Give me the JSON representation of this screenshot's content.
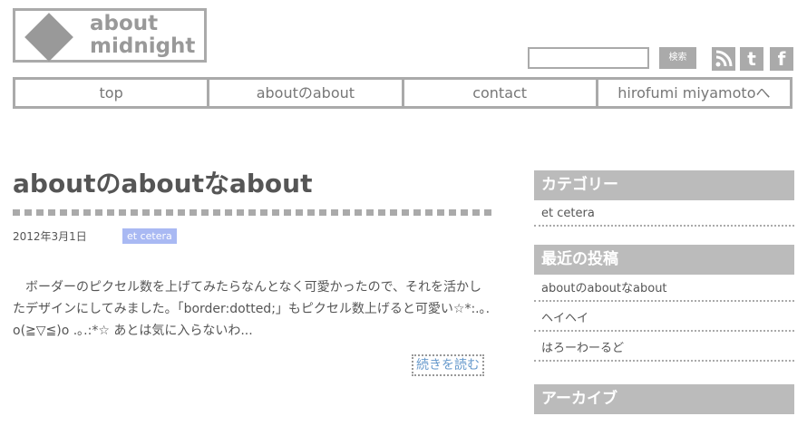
{
  "logo": {
    "line1": "about",
    "line2": "midnight"
  },
  "search": {
    "placeholder": "",
    "button_label": "検索"
  },
  "social": {
    "rss": "RSS",
    "twitter": "t",
    "facebook": "f"
  },
  "nav": {
    "items": [
      "top",
      "aboutのabout",
      "contact",
      "hirofumi miyamotoへ"
    ]
  },
  "post": {
    "title": "aboutのaboutなabout",
    "date": "2012年3月1日",
    "category": "et cetera",
    "body": "　ボーダーのピクセル数を上げてみたらなんとなく可愛かったので、それを活かしたデザインにしてみました。「border:dotted;」もピクセル数上げると可愛い☆*:.｡. o(≧▽≦)o .｡.:*☆ あとは気に入らないわ...",
    "read_more": "続きを読む"
  },
  "sidebar": {
    "categories": {
      "heading": "カテゴリー",
      "items": [
        "et cetera"
      ]
    },
    "recent": {
      "heading": "最近の投稿",
      "items": [
        "aboutのaboutなabout",
        "ヘイヘイ",
        "はろーわーるど"
      ]
    },
    "archives": {
      "heading": "アーカイブ"
    }
  }
}
